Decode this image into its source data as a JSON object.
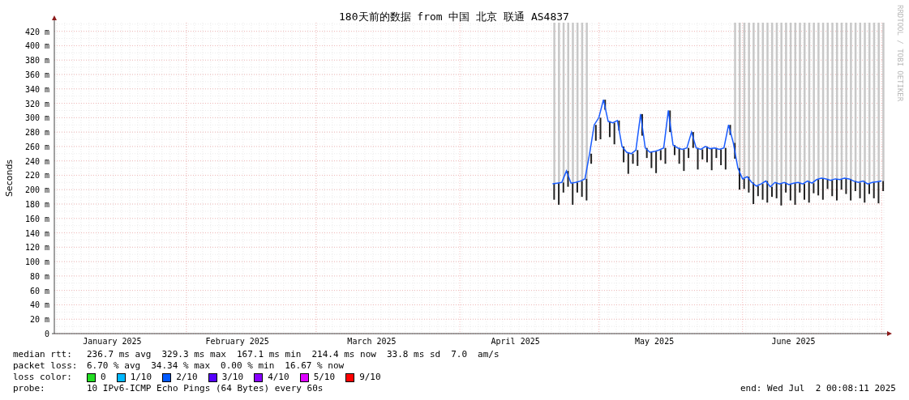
{
  "side_label": "RRDTOOL / TOBI OETIKER",
  "chart_data": {
    "type": "line",
    "grid": true,
    "title": "180天前的数据 from 中国 北京 联通 AS4837",
    "ylabel": "Seconds",
    "ylim": [
      0,
      432
    ],
    "categories": [
      null,
      null,
      null,
      null,
      null,
      null,
      null,
      null,
      null,
      null,
      null,
      null,
      "January 2025",
      null,
      null,
      null,
      null,
      null,
      null,
      null,
      null,
      null,
      null,
      null,
      null,
      null,
      null,
      null,
      null,
      null,
      null,
      null,
      null,
      null,
      null,
      null,
      null,
      null,
      null,
      "February 2025",
      null,
      null,
      null,
      null,
      null,
      null,
      null,
      null,
      null,
      null,
      null,
      null,
      null,
      null,
      null,
      null,
      null,
      null,
      null,
      null,
      null,
      null,
      null,
      null,
      null,
      null,
      null,
      null,
      "March 2025",
      null,
      null,
      null,
      null,
      null,
      null,
      null,
      null,
      null,
      null,
      null,
      null,
      null,
      null,
      null,
      null,
      null,
      null,
      null,
      null,
      null,
      null,
      null,
      null,
      null,
      null,
      null,
      null,
      null,
      null,
      "April 2025",
      null,
      null,
      null,
      null,
      null,
      null,
      null,
      null,
      null,
      null,
      null,
      null,
      null,
      null,
      null,
      null,
      null,
      null,
      null,
      null,
      null,
      null,
      null,
      null,
      null,
      null,
      null,
      null,
      null,
      "May 2025",
      null,
      null,
      null,
      null,
      null,
      null,
      null,
      null,
      null,
      null,
      null,
      null,
      null,
      null,
      null,
      null,
      null,
      null,
      null,
      null,
      null,
      null,
      null,
      null,
      null,
      null,
      null,
      null,
      null,
      "June 2025",
      null,
      null,
      null,
      null,
      null,
      null,
      null,
      null,
      null,
      null,
      null,
      null,
      null,
      null,
      null,
      null,
      null,
      null,
      null
    ],
    "yticks": [
      {
        "value": 0,
        "label": "0"
      },
      {
        "value": 20,
        "label": "20 m"
      },
      {
        "value": 40,
        "label": "40 m"
      },
      {
        "value": 60,
        "label": "60 m"
      },
      {
        "value": 80,
        "label": "80 m"
      },
      {
        "value": 100,
        "label": "100 m"
      },
      {
        "value": 120,
        "label": "120 m"
      },
      {
        "value": 140,
        "label": "140 m"
      },
      {
        "value": 160,
        "label": "160 m"
      },
      {
        "value": 180,
        "label": "180 m"
      },
      {
        "value": 200,
        "label": "200 m"
      },
      {
        "value": 220,
        "label": "220 m"
      },
      {
        "value": 240,
        "label": "240 m"
      },
      {
        "value": 260,
        "label": "260 m"
      },
      {
        "value": 280,
        "label": "280 m"
      },
      {
        "value": 300,
        "label": "300 m"
      },
      {
        "value": 320,
        "label": "320 m"
      },
      {
        "value": 340,
        "label": "340 m"
      },
      {
        "value": 360,
        "label": "360 m"
      },
      {
        "value": 380,
        "label": "380 m"
      },
      {
        "value": 400,
        "label": "400 m"
      },
      {
        "value": 420,
        "label": "420 m"
      }
    ],
    "series": [
      {
        "color": "#1a5cff",
        "values": [
          null,
          null,
          null,
          null,
          null,
          null,
          null,
          null,
          null,
          null,
          null,
          null,
          null,
          null,
          null,
          null,
          null,
          null,
          null,
          null,
          null,
          null,
          null,
          null,
          null,
          null,
          null,
          null,
          null,
          null,
          null,
          null,
          null,
          null,
          null,
          null,
          null,
          null,
          null,
          null,
          null,
          null,
          null,
          null,
          null,
          null,
          null,
          null,
          null,
          null,
          null,
          null,
          null,
          null,
          null,
          null,
          null,
          null,
          null,
          null,
          null,
          null,
          null,
          null,
          null,
          null,
          null,
          null,
          null,
          null,
          null,
          null,
          null,
          null,
          null,
          null,
          null,
          null,
          null,
          null,
          null,
          null,
          null,
          null,
          null,
          null,
          null,
          null,
          null,
          null,
          null,
          null,
          null,
          null,
          null,
          null,
          null,
          null,
          null,
          null,
          null,
          null,
          null,
          null,
          null,
          null,
          null,
          208,
          209,
          210,
          226,
          209,
          210,
          212,
          215,
          250,
          290,
          300,
          325,
          295,
          293,
          296,
          260,
          252,
          250,
          255,
          305,
          258,
          252,
          253,
          255,
          258,
          310,
          262,
          258,
          256,
          258,
          280,
          258,
          256,
          260,
          257,
          258,
          256,
          258,
          290,
          265,
          230,
          215,
          218,
          210,
          205,
          208,
          212,
          204,
          210,
          208,
          210,
          207,
          209,
          210,
          208,
          212,
          209,
          214,
          216,
          215,
          213,
          215,
          214,
          216,
          215,
          212,
          210,
          212,
          208,
          210,
          211,
          212
        ]
      }
    ]
  },
  "legend": {
    "median_rtt": {
      "label": "median rtt:",
      "values": [
        "236.7 ms avg",
        "329.3 ms max",
        "167.1 ms min",
        "214.4 ms now",
        "33.8 ms sd",
        "7.0",
        "am/s"
      ]
    },
    "packet_loss": {
      "label": "packet loss:",
      "values": [
        "6.70 % avg",
        "34.34 % max",
        "0.00 % min",
        "16.67 % now"
      ]
    },
    "loss_color": {
      "label": "loss color:",
      "items": [
        {
          "label": "0",
          "color": "#22dd22"
        },
        {
          "label": "1/10",
          "color": "#00b8ff"
        },
        {
          "label": "2/10",
          "color": "#0059ff"
        },
        {
          "label": "3/10",
          "color": "#5500ff"
        },
        {
          "label": "4/10",
          "color": "#8800ff"
        },
        {
          "label": "5/10",
          "color": "#dd00ff"
        },
        {
          "label": "9/10",
          "color": "#ff0000"
        }
      ]
    },
    "probe": {
      "label": "probe:",
      "value": "10 IPv6-ICMP Echo Pings (64 Bytes) every 60s"
    },
    "end": "end: Wed Jul  2 00:08:11 2025"
  }
}
